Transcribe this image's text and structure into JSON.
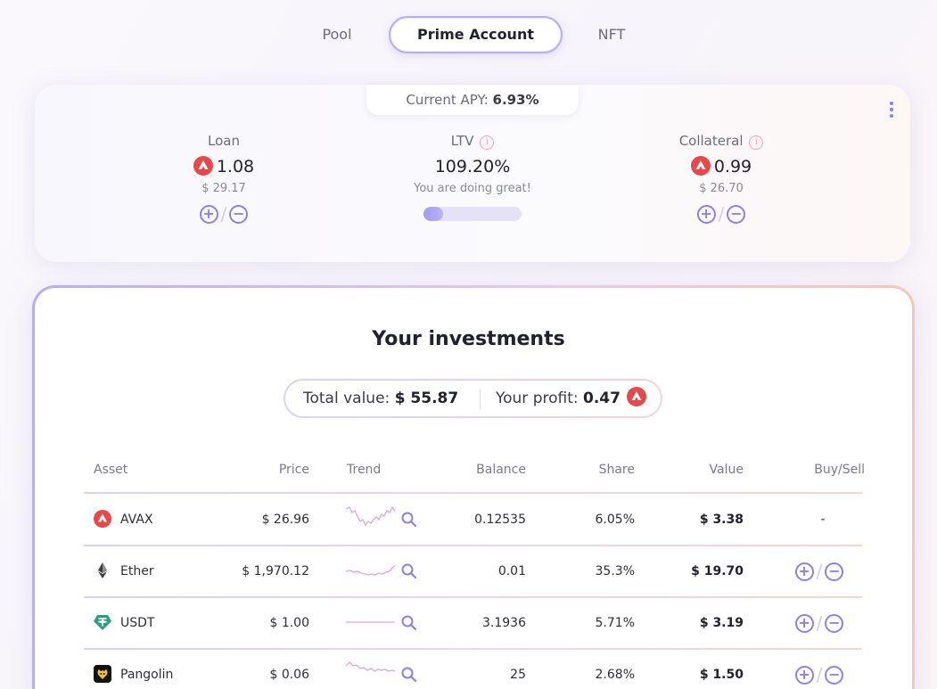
{
  "tabs": [
    {
      "label": "Pool"
    },
    {
      "label": "Prime Account",
      "active": true
    },
    {
      "label": "NFT"
    }
  ],
  "summary_card": {
    "apy_label": "Current APY:",
    "apy_value": "6.93%",
    "loan": {
      "label": "Loan",
      "amount": "1.08",
      "usd": "$ 29.17"
    },
    "ltv": {
      "label": "LTV",
      "value": "109.20%",
      "status": "You are doing great!",
      "bar_fraction": 0.2
    },
    "collateral": {
      "label": "Collateral",
      "amount": "0.99",
      "usd": "$ 26.70"
    },
    "plus_symbol": "+",
    "minus_symbol": "−",
    "slash": "/"
  },
  "investments": {
    "title": "Your investments",
    "total_label": "Total value:",
    "total_value": "$ 55.87",
    "profit_label": "Your profit:",
    "profit_value": "0.47",
    "columns": [
      "Asset",
      "Price",
      "Trend",
      "Balance",
      "Share",
      "Value",
      "Buy/Sell"
    ],
    "rows": [
      {
        "asset": "AVAX",
        "icon": "avax-icon",
        "price": "$ 26.96",
        "balance": "0.12535",
        "share": "6.05%",
        "value": "$ 3.38",
        "buysell": "-"
      },
      {
        "asset": "Ether",
        "icon": "ether-icon",
        "price": "$ 1,970.12",
        "balance": "0.01",
        "share": "35.3%",
        "value": "$ 19.70",
        "buysell": ""
      },
      {
        "asset": "USDT",
        "icon": "usdt-icon",
        "price": "$ 1.00",
        "balance": "3.1936",
        "share": "5.71%",
        "value": "$ 3.19",
        "buysell": ""
      },
      {
        "asset": "Pangolin",
        "icon": "pangolin-icon",
        "price": "$ 0.06",
        "balance": "25",
        "share": "2.68%",
        "value": "$ 1.50",
        "buysell": ""
      }
    ]
  },
  "colors": {
    "accent": "#8b80ee",
    "avax_red": "#e8484a",
    "usdt_green": "#26a17b",
    "sparkline": "#e0a6df"
  }
}
